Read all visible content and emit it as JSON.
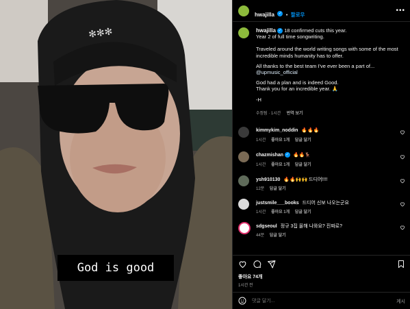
{
  "post": {
    "username": "hwajilla",
    "follow_label": "팔로우",
    "caption_lines": [
      "18 confirmed cuts this year.",
      "Year 2 of full time songwriting.",
      "",
      "Traveled around the world writing songs with some of the most incredible minds humanity has to offer.",
      "",
      "All thanks to the best team I've ever been a part of...",
      "@upmusic_official",
      "",
      "God had a plan and is indeed Good.",
      "Thank you for an incredible year. 🙏",
      "",
      "-H"
    ],
    "caption_meta": "수정됨 · 1시간",
    "translate_label": "번역 보기",
    "photo_caption": "God is good"
  },
  "comments": [
    {
      "user": "kimmykim_noddin",
      "text": "🔥🔥🔥",
      "time": "1시간",
      "likes": "좋아요 1개",
      "reply": "답글 달기",
      "verified": false
    },
    {
      "user": "chazmishan",
      "text": "🔥🔥🦌",
      "time": "1시간",
      "likes": "좋아요 1개",
      "reply": "답글 달기",
      "verified": true
    },
    {
      "user": "ysh910130",
      "text": "🔥🔥🙌🙌 드디어!!!!",
      "time": "12분",
      "likes": "",
      "reply": "답글 달기",
      "verified": false
    },
    {
      "user": "justsmile___books",
      "text": "드디어 신보 나오는군요",
      "time": "1시간",
      "likes": "좋아요 1개",
      "reply": "답글 달기",
      "verified": false
    },
    {
      "user": "sdgseoul",
      "text": "정규 3집 올해 나와요? 진짜로?",
      "time": "44분",
      "likes": "",
      "reply": "답글 달기",
      "verified": false
    }
  ],
  "footer": {
    "likes": "좋아요 74개",
    "time": "1시간 전",
    "comment_placeholder": "댓글 달기...",
    "post_button": "게시"
  },
  "icons": {
    "more": "more-icon",
    "like": "heart-icon",
    "comment": "comment-icon",
    "share": "share-icon",
    "save": "bookmark-icon",
    "emoji": "emoji-icon"
  },
  "colors": {
    "follow": "#0095f6",
    "verified": "#0095f6",
    "link": "#e0f1ff"
  }
}
